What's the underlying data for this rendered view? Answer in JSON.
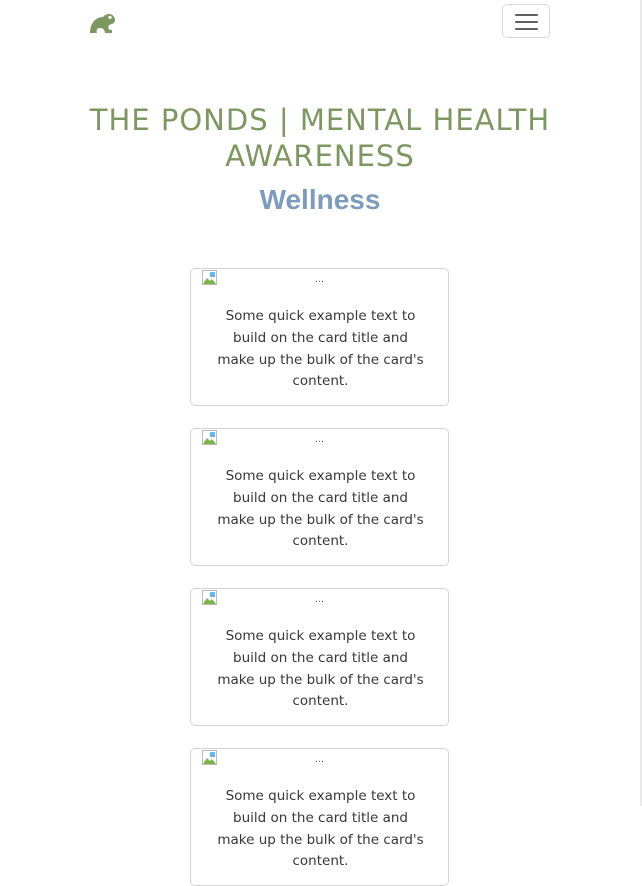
{
  "header": {
    "logo_icon": "frog-icon",
    "menu_icon": "hamburger-menu-icon"
  },
  "main": {
    "title": "THE PONDS | MENTAL HEALTH AWARENESS",
    "subtitle": "Wellness"
  },
  "cards": [
    {
      "image_alt": "...",
      "text": "Some quick example text to build on the card title and make up the bulk of the card's content."
    },
    {
      "image_alt": "...",
      "text": "Some quick example text to build on the card title and make up the bulk of the card's content."
    },
    {
      "image_alt": "...",
      "text": "Some quick example text to build on the card title and make up the bulk of the card's content."
    },
    {
      "image_alt": "...",
      "text": "Some quick example text to build on the card title and make up the bulk of the card's content."
    }
  ],
  "colors": {
    "title": "#7d9760",
    "subtitle": "#7d9cbc",
    "logo": "#7d9760"
  }
}
